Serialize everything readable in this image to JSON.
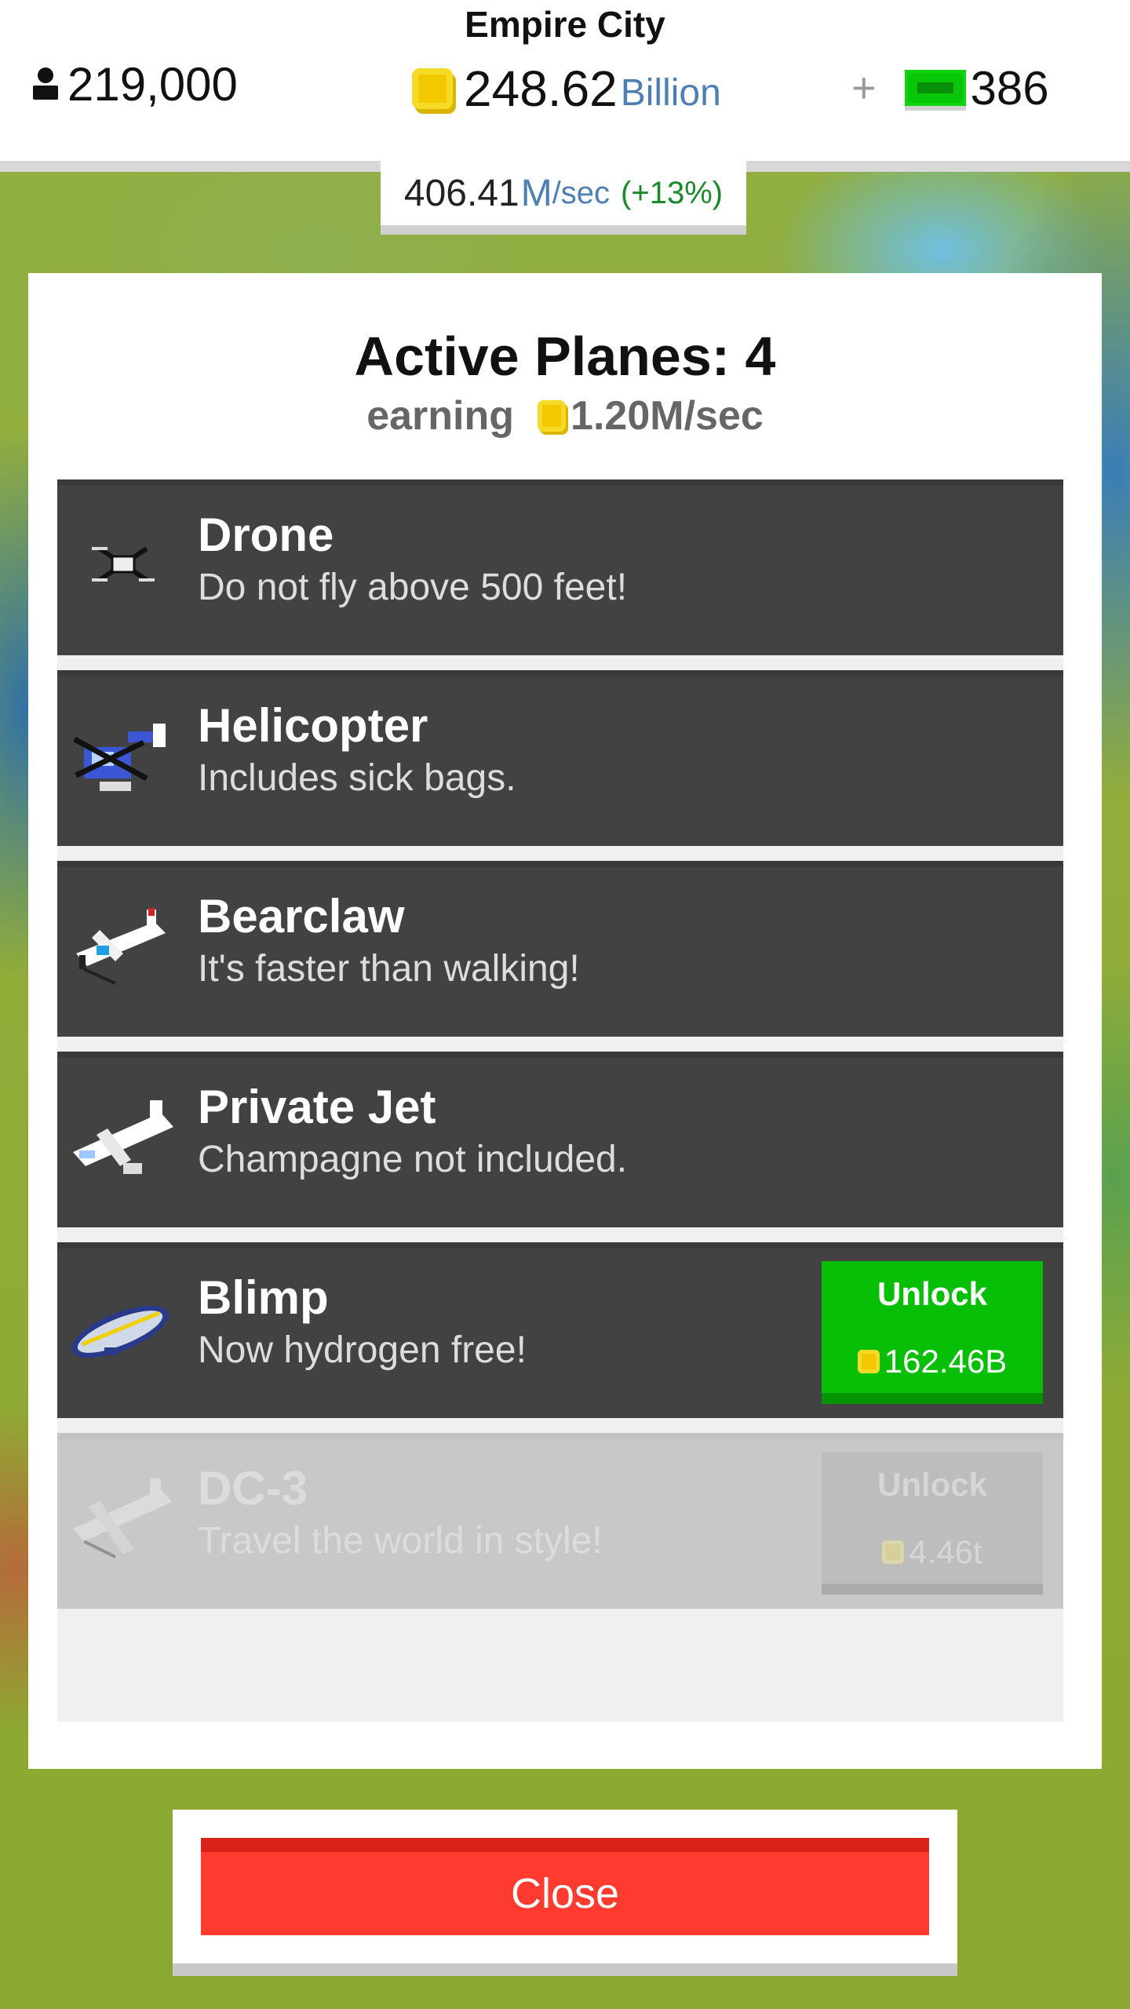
{
  "hud": {
    "city_name": "Empire City",
    "population": "219,000",
    "money_value": "248.62",
    "money_unit": "Billion",
    "plus_label": "+",
    "cash_value": "386"
  },
  "rate": {
    "value": "406.41",
    "unit": "M",
    "per": "/sec",
    "bonus": "(+13%)"
  },
  "panel": {
    "title": "Active Planes: 4",
    "earning_label": "earning",
    "earning_value": "1.20M/sec"
  },
  "planes": [
    {
      "name": "Drone",
      "desc": "Do not fly above 500 feet!",
      "icon": "drone-icon"
    },
    {
      "name": "Helicopter",
      "desc": "Includes sick bags.",
      "icon": "helicopter-icon"
    },
    {
      "name": "Bearclaw",
      "desc": "It's faster than walking!",
      "icon": "bearclaw-plane-icon"
    },
    {
      "name": "Private Jet",
      "desc": "Champagne not included.",
      "icon": "private-jet-icon"
    },
    {
      "name": "Blimp",
      "desc": "Now hydrogen free!",
      "icon": "blimp-icon",
      "unlock_label": "Unlock",
      "price": "162.46B"
    },
    {
      "name": "DC-3",
      "desc": "Travel the world in style!",
      "icon": "dc3-plane-icon",
      "unlock_label": "Unlock",
      "price": "4.46t",
      "locked": true
    }
  ],
  "close_label": "Close",
  "colors": {
    "unlock_green": "#06bf06",
    "close_red": "#ff3a2e",
    "item_dark": "#424242",
    "coin_gold": "#f3c800",
    "accent_blue": "#4d7fb3"
  }
}
